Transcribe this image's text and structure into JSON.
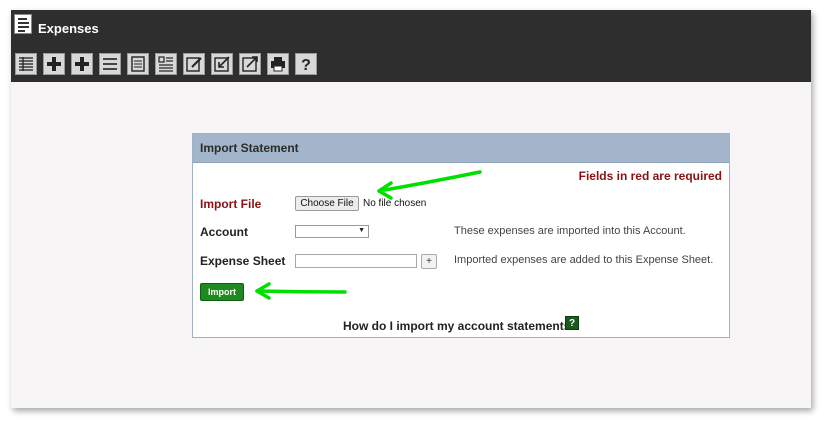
{
  "app": {
    "title": "Expenses"
  },
  "toolbar": {
    "icons": [
      "list-icon",
      "add-icon",
      "add-alt-icon",
      "lines-icon",
      "document-icon",
      "report-icon",
      "edit-icon",
      "import-icon",
      "export-icon",
      "print-icon",
      "help-icon"
    ]
  },
  "panel": {
    "title": "Import Statement",
    "required_note": "Fields in red are required",
    "import_file_label": "Import File",
    "choose_file_label": "Choose File",
    "file_status": "No file chosen",
    "account_label": "Account",
    "account_value": "",
    "account_help": "These expenses are imported into this Account.",
    "expense_sheet_label": "Expense Sheet",
    "expense_sheet_value": "",
    "plus_label": "+",
    "expense_sheet_help": "Imported expenses are added to this Expense Sheet.",
    "import_button": "Import",
    "help_link": "How do I import my account statements?",
    "help_q": "?"
  },
  "colors": {
    "topbar": "#2e2e2e",
    "header": "#a3b5ca",
    "required": "#8b1010",
    "import_btn": "#1f8a1f",
    "annotation": "#00e000"
  }
}
